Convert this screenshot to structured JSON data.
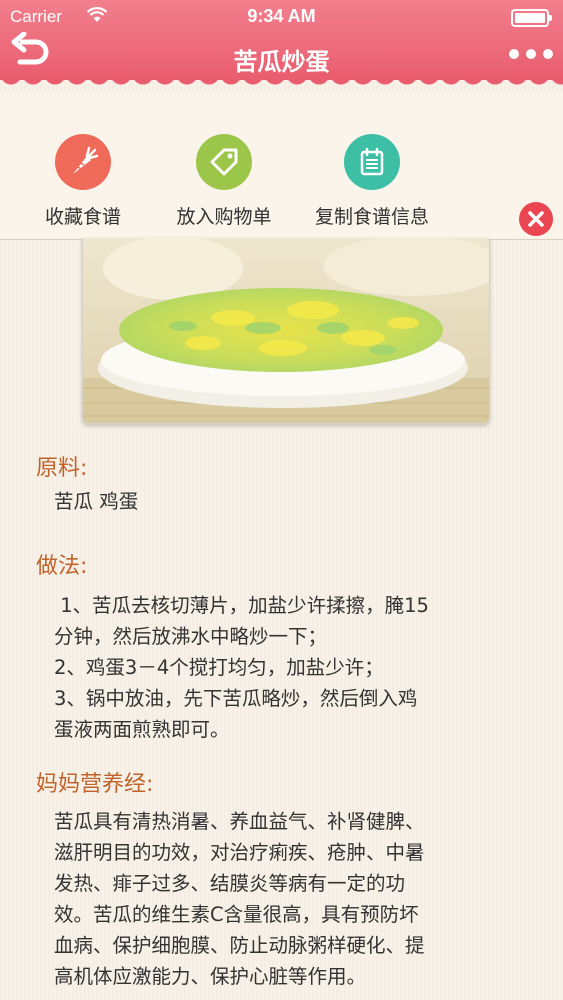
{
  "status": {
    "carrier": "Carrier",
    "time": "9:34 AM"
  },
  "nav": {
    "title": "苦瓜炒蛋"
  },
  "actions": {
    "favorite": "收藏食谱",
    "cart": "放入购物单",
    "copy": "复制食谱信息"
  },
  "colors": {
    "header": "#e95d6f",
    "favorite": "#f06a5a",
    "cart": "#9cc64a",
    "copy": "#3dbfa5",
    "section_title": "#c1622a",
    "close": "#e94652"
  },
  "icons": {
    "favorite": "carrot-icon",
    "cart": "tag-icon",
    "copy": "clipboard-icon"
  },
  "sections": {
    "ingredients": {
      "title": "原料:",
      "text": "苦瓜 鸡蛋"
    },
    "method": {
      "title": "做法:",
      "lines": [
        " 1、苦瓜去核切薄片，加盐少许揉擦，腌15",
        "分钟，然后放沸水中略炒一下；",
        "2、鸡蛋3－4个搅打均匀，加盐少许；",
        "3、锅中放油，先下苦瓜略炒，然后倒入鸡",
        "蛋液两面煎熟即可。"
      ]
    },
    "nutrition": {
      "title": "妈妈营养经:",
      "lines": [
        "苦瓜具有清热消暑、养血益气、补肾健脾、",
        "滋肝明目的功效，对治疗痢疾、疮肿、中暑",
        "发热、痱子过多、结膜炎等病有一定的功",
        "效。苦瓜的维生素C含量很高，具有预防坏",
        "血病、保护细胞膜、防止动脉粥样硬化、提",
        "高机体应激能力、保护心脏等作用。"
      ]
    }
  }
}
